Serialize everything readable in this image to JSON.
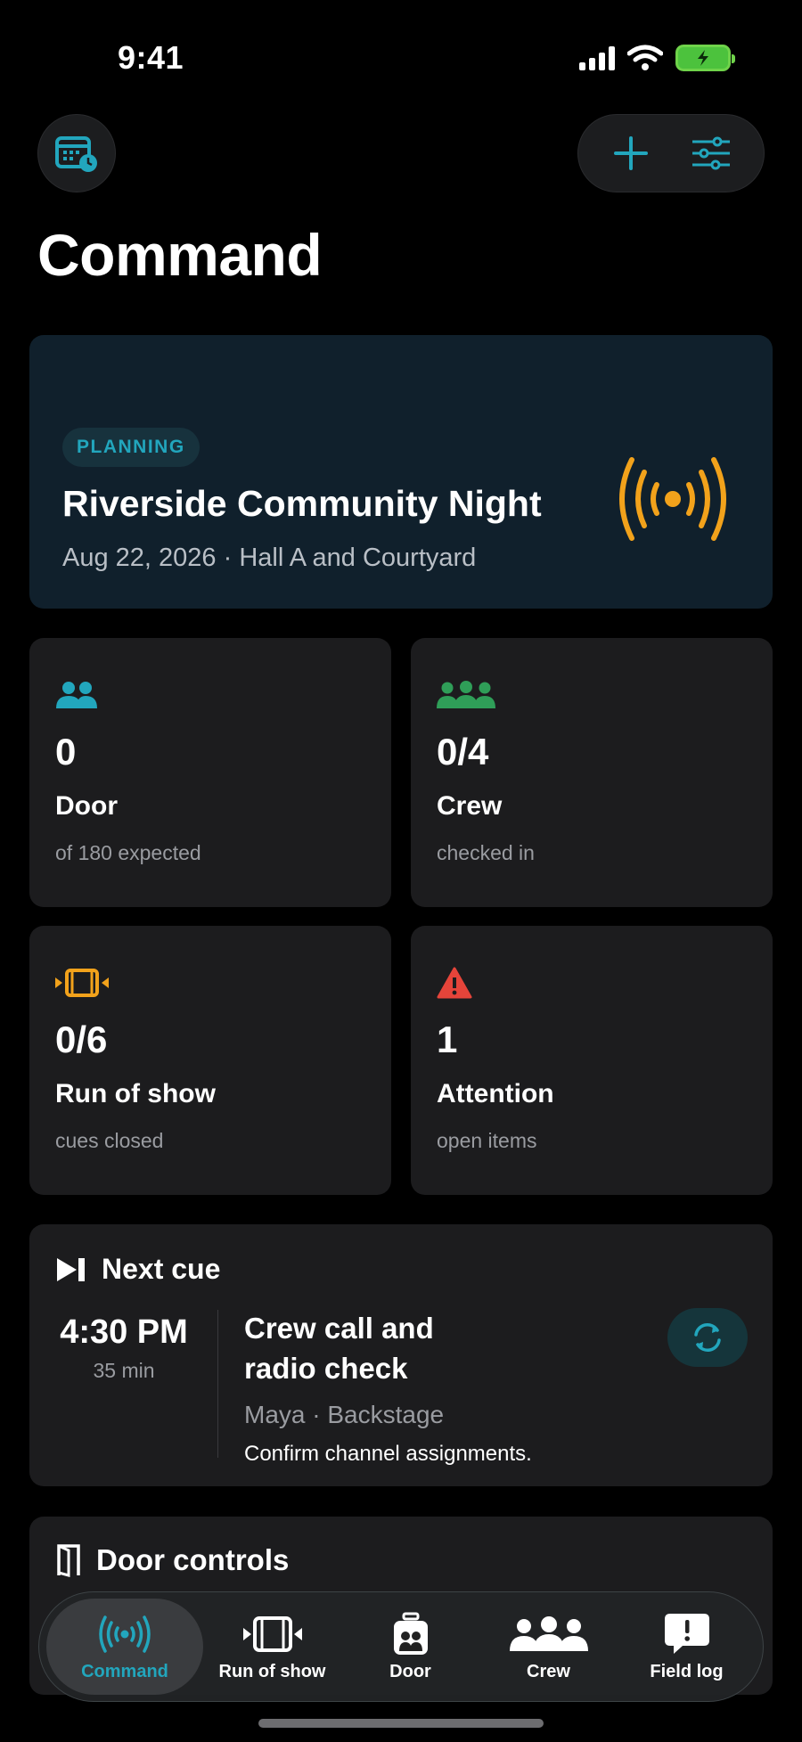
{
  "status_bar": {
    "time": "9:41"
  },
  "header": {
    "title": "Command"
  },
  "event": {
    "status": "PLANNING",
    "name": "Riverside Community Night",
    "details": "Aug 22, 2026 · Hall A and Courtyard"
  },
  "stats": [
    {
      "value": "0",
      "label": "Door",
      "caption": "of 180 expected",
      "icon": "people-icon",
      "color": "#22a6bd"
    },
    {
      "value": "0/4",
      "label": "Crew",
      "caption": "checked in",
      "icon": "crew-icon",
      "color": "#2f9e58"
    },
    {
      "value": "0/6",
      "label": "Run of show",
      "caption": "cues closed",
      "icon": "film-icon",
      "color": "#f2a21b"
    },
    {
      "value": "1",
      "label": "Attention",
      "caption": "open items",
      "icon": "warning-icon",
      "color": "#e5443a"
    }
  ],
  "next_cue": {
    "heading": "Next cue",
    "time": "4:30 PM",
    "duration": "35 min",
    "title": "Crew call and radio check",
    "meta": "Maya · Backstage",
    "note": "Confirm channel assignments."
  },
  "door_controls": {
    "heading": "Door controls"
  },
  "tabs": [
    {
      "label": "Command",
      "active": true
    },
    {
      "label": "Run of show"
    },
    {
      "label": "Door"
    },
    {
      "label": "Crew"
    },
    {
      "label": "Field log"
    }
  ],
  "colors": {
    "accent": "#22a6bd",
    "broadcast": "#f2a21b",
    "card": "#1c1c1e",
    "event_card": "#10202c"
  }
}
